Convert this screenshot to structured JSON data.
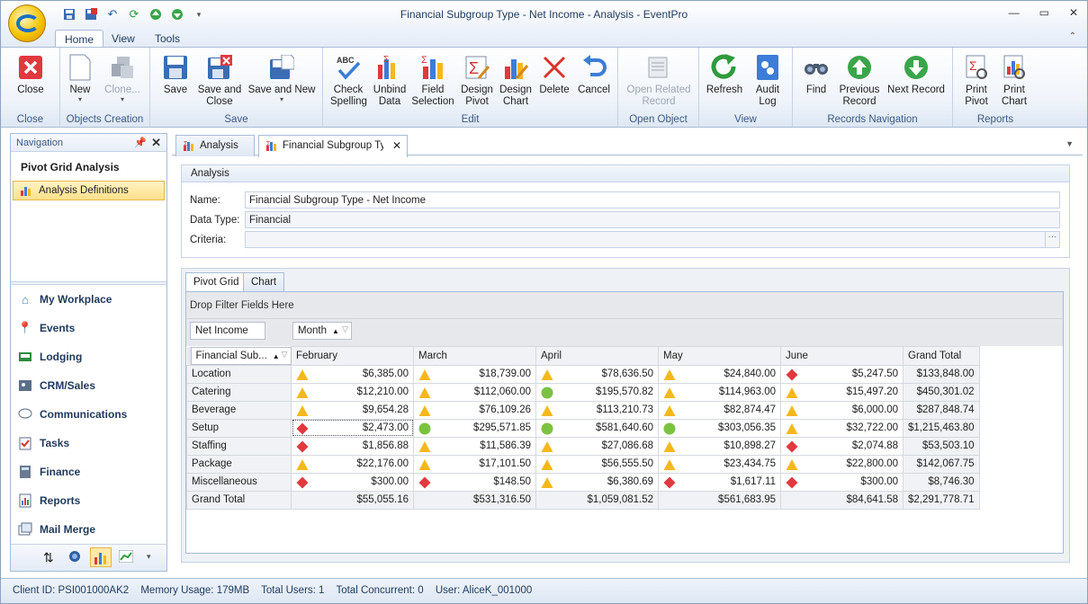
{
  "window": {
    "title": "Financial Subgroup Type - Net Income - Analysis - EventPro"
  },
  "ribbon_tabs": [
    "Home",
    "View",
    "Tools"
  ],
  "ribbon": {
    "groups": [
      "Close",
      "Objects Creation",
      "Save",
      "Edit",
      "Open Object",
      "View",
      "Records Navigation",
      "Reports"
    ],
    "buttons": {
      "close": "Close",
      "new": "New",
      "clone": "Clone...",
      "save": "Save",
      "save_close": "Save and\nClose",
      "save_new": "Save and New",
      "check_spelling": "Check\nSpelling",
      "unbind_data": "Unbind\nData",
      "field_selection": "Field\nSelection",
      "design_pivot": "Design\nPivot",
      "design_chart": "Design\nChart",
      "delete": "Delete",
      "cancel": "Cancel",
      "open_related": "Open Related\nRecord",
      "refresh": "Refresh",
      "audit_log": "Audit\nLog",
      "find": "Find",
      "previous_record": "Previous\nRecord",
      "next_record": "Next Record",
      "print_pivot": "Print\nPivot",
      "print_chart": "Print\nChart"
    }
  },
  "navigation": {
    "header": "Navigation",
    "section": "Pivot Grid Analysis",
    "selected": "Analysis Definitions",
    "items": [
      "My Workplace",
      "Events",
      "Lodging",
      "CRM/Sales",
      "Communications",
      "Tasks",
      "Finance",
      "Reports",
      "Mail Merge"
    ]
  },
  "doc_tabs": [
    "Analysis",
    "Financial Subgroup Type"
  ],
  "analysis": {
    "group_title": "Analysis",
    "name_label": "Name:",
    "name_value": "Financial Subgroup Type - Net Income",
    "datatype_label": "Data Type:",
    "datatype_value": "Financial",
    "criteria_label": "Criteria:",
    "criteria_value": ""
  },
  "pivot": {
    "tabs": [
      "Pivot Grid",
      "Chart"
    ],
    "filter_text": "Drop Filter Fields Here",
    "data_field": "Net Income",
    "column_field": "Month",
    "row_field": "Financial Sub...",
    "columns": [
      "February",
      "March",
      "April",
      "May",
      "June",
      "Grand Total"
    ],
    "rows": [
      {
        "label": "Location",
        "values": [
          "$6,385.00",
          "$18,739.00",
          "$78,636.50",
          "$24,840.00",
          "$5,247.50"
        ],
        "kpi": [
          "tri",
          "tri",
          "tri",
          "tri",
          "dia"
        ],
        "total": "$133,848.00"
      },
      {
        "label": "Catering",
        "values": [
          "$12,210.00",
          "$112,060.00",
          "$195,570.82",
          "$114,963.00",
          "$15,497.20"
        ],
        "kpi": [
          "tri",
          "tri",
          "circ",
          "tri",
          "tri"
        ],
        "total": "$450,301.02"
      },
      {
        "label": "Beverage",
        "values": [
          "$9,654.28",
          "$76,109.26",
          "$113,210.73",
          "$82,874.47",
          "$6,000.00"
        ],
        "kpi": [
          "tri",
          "tri",
          "tri",
          "tri",
          "tri"
        ],
        "total": "$287,848.74"
      },
      {
        "label": "Setup",
        "values": [
          "$2,473.00",
          "$295,571.85",
          "$581,640.60",
          "$303,056.35",
          "$32,722.00"
        ],
        "kpi": [
          "dia",
          "circ",
          "circ",
          "circ",
          "tri"
        ],
        "total": "$1,215,463.80"
      },
      {
        "label": "Staffing",
        "values": [
          "$1,856.88",
          "$11,586.39",
          "$27,086.68",
          "$10,898.27",
          "$2,074.88"
        ],
        "kpi": [
          "dia",
          "tri",
          "tri",
          "tri",
          "dia"
        ],
        "total": "$53,503.10"
      },
      {
        "label": "Package",
        "values": [
          "$22,176.00",
          "$17,101.50",
          "$56,555.50",
          "$23,434.75",
          "$22,800.00"
        ],
        "kpi": [
          "tri",
          "tri",
          "tri",
          "tri",
          "tri"
        ],
        "total": "$142,067.75"
      },
      {
        "label": "Miscellaneous",
        "values": [
          "$300.00",
          "$148.50",
          "$6,380.69",
          "$1,617.11",
          "$300.00"
        ],
        "kpi": [
          "dia",
          "dia",
          "tri",
          "dia",
          "dia"
        ],
        "total": "$8,746.30"
      }
    ],
    "grand_total_label": "Grand Total",
    "grand_totals": [
      "$55,055.16",
      "$531,316.50",
      "$1,059,081.52",
      "$561,683.95",
      "$84,641.58",
      "$2,291,778.71"
    ]
  },
  "status": {
    "client_id": "Client ID: PSI001000AK2",
    "memory": "Memory Usage: 179MB",
    "total_users": "Total Users: 1",
    "total_concurrent": "Total Concurrent: 0",
    "user": "User: AliceK_001000"
  },
  "colors": {
    "kpi_triangle": "#f5b81c",
    "kpi_circle": "#7cc242",
    "kpi_diamond": "#e0393e",
    "selection": "#ffe08a"
  }
}
